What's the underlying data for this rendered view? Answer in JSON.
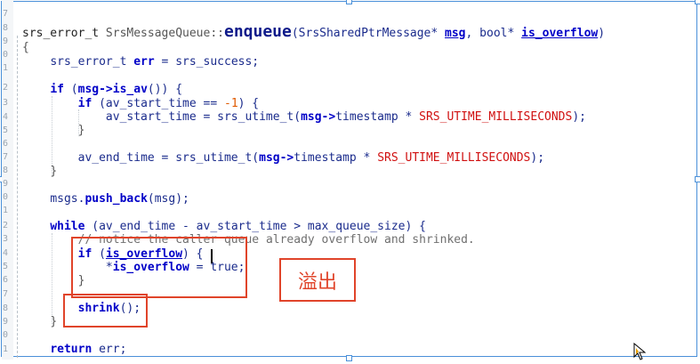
{
  "annotation": "溢出",
  "code": {
    "sig_type": "srs_error_t",
    "sig_class": "SrsMessageQueue",
    "sig_sep": "::",
    "sig_fn": "enqueue",
    "sig_open": "(SrsSharedPtrMessage* ",
    "sig_msg": "msg",
    "sig_mid": ", bool* ",
    "sig_ov": "is_overflow",
    "sig_close": ")",
    "open_brace": "{",
    "l1_type": "srs_error_t ",
    "l1_var": "err",
    "l1_eq": " = ",
    "l1_val": "srs_success",
    "l1_end": ";",
    "l2_if": "if",
    "l2_a": " (",
    "l2_msg": "msg->",
    "l2_call": "is_av",
    "l2_b": "()) {",
    "l3_if": "if",
    "l3_a": " (av_start_time == ",
    "l3_num": "-1",
    "l3_b": ") {",
    "l4_a": "av_start_time = srs_utime_t(",
    "l4_msg": "msg->",
    "l4_b": "timestamp * ",
    "l4_mac": "SRS_UTIME_MILLISECONDS",
    "l4_c": ");",
    "l5": "}",
    "l6_a": "av_end_time = srs_utime_t(",
    "l6_msg": "msg->",
    "l6_b": "timestamp * ",
    "l6_mac": "SRS_UTIME_MILLISECONDS",
    "l6_c": ");",
    "l7": "}",
    "l8_a": "msgs.",
    "l8_fn": "push_back",
    "l8_b": "(msg);",
    "l9_kw": "while",
    "l9_a": " (av_end_time - av_start_time > max_queue_size) {",
    "l10": "// notice the caller queue already overflow and shrinked.",
    "l11_if": "if",
    "l11_a": " (",
    "l11_v": "is_overflow",
    "l11_b": ") {",
    "l12_a": "*",
    "l12_v": "is_overflow",
    "l12_b": " = true;",
    "l13": "}",
    "l14_fn": "shrink",
    "l14_a": "();",
    "l15": "}",
    "l16_kw": "return",
    "l16_a": " err;"
  },
  "gutter_numbers": [
    "7",
    "",
    "",
    "",
    "",
    "",
    "",
    "",
    "",
    "",
    "",
    "1",
    "2",
    "3",
    "4",
    "5",
    "6",
    "7",
    "8",
    "9",
    "0",
    "1",
    "2",
    "3",
    "4",
    "5",
    "6",
    "7",
    "8",
    "9",
    "0",
    "1",
    "2"
  ]
}
